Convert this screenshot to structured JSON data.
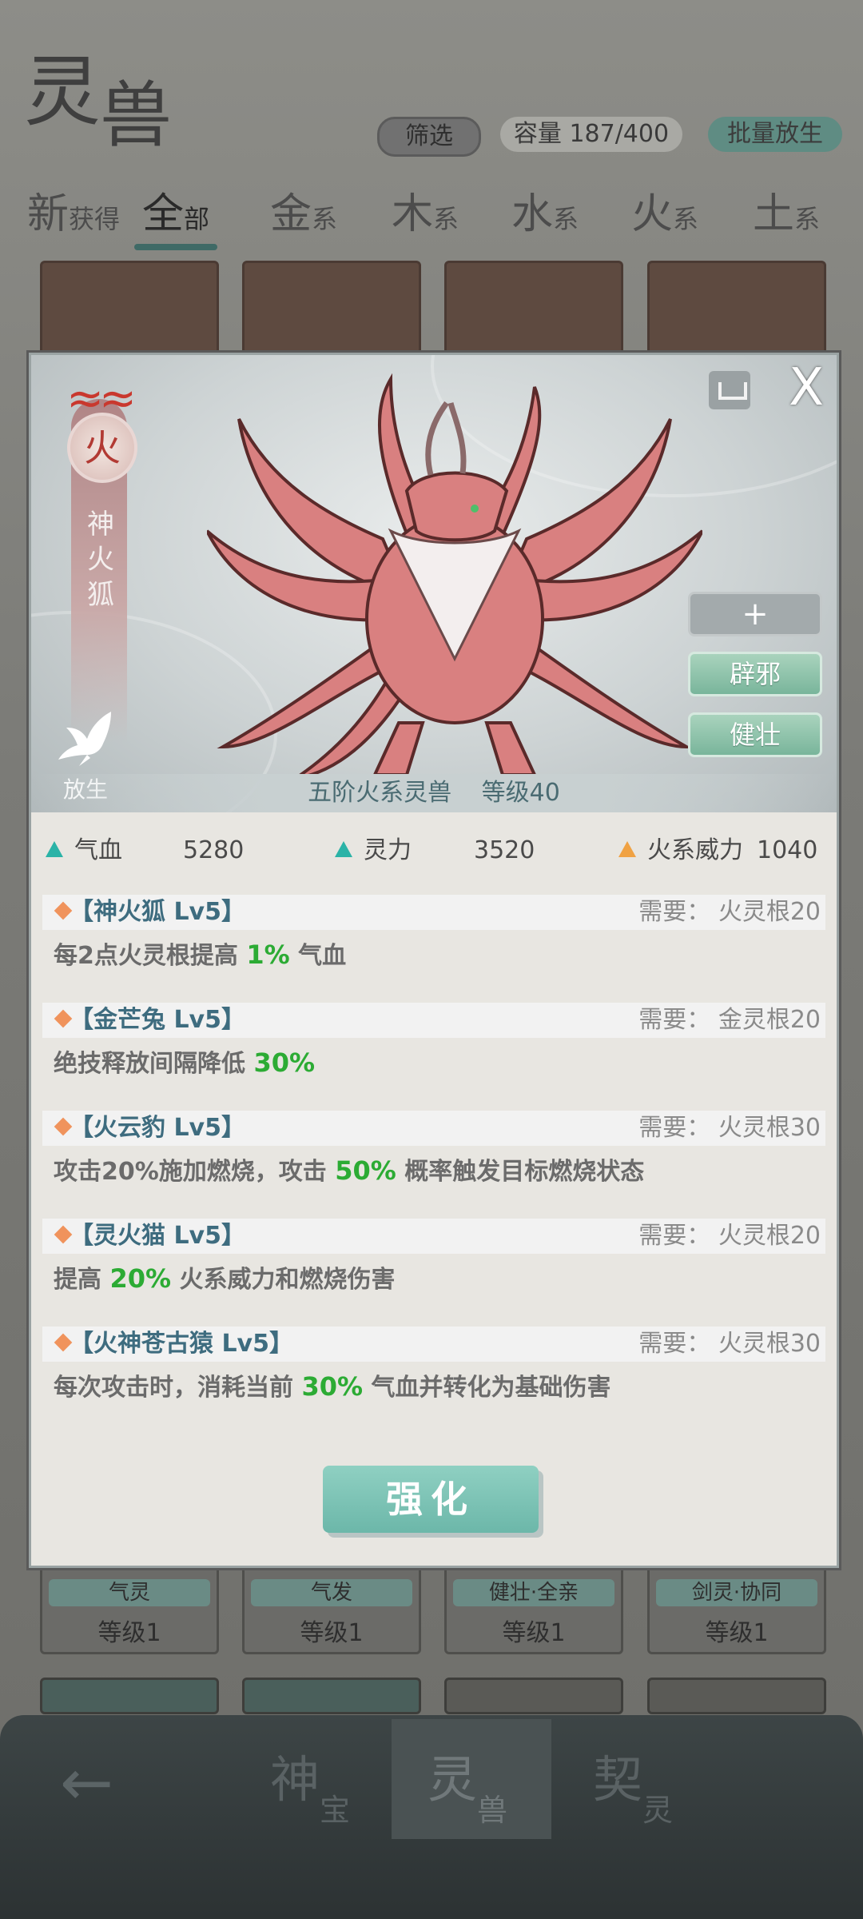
{
  "background": {
    "logo": {
      "char1": "灵",
      "char2": "兽"
    },
    "filter_label": "筛选",
    "capacity_label": "容量 187/400",
    "batch_release_label": "批量放生",
    "tabs": [
      {
        "big": "新",
        "small": "获得"
      },
      {
        "big": "全",
        "small": "部"
      },
      {
        "big": "金",
        "small": "系"
      },
      {
        "big": "木",
        "small": "系"
      },
      {
        "big": "水",
        "small": "系"
      },
      {
        "big": "火",
        "small": "系"
      },
      {
        "big": "土",
        "small": "系"
      }
    ],
    "cards_bottom": [
      {
        "label": "气灵",
        "level": "等级1"
      },
      {
        "label": "气发",
        "level": "等级1"
      },
      {
        "label": "健壮·全亲",
        "level": "等级1"
      },
      {
        "label": "剑灵·协同",
        "level": "等级1"
      }
    ],
    "bottom_nav": [
      {
        "big": "神",
        "small": "宝"
      },
      {
        "big": "灵",
        "small": "兽"
      },
      {
        "big": "契",
        "small": "灵"
      }
    ]
  },
  "modal": {
    "element_char": "火",
    "beast_name": "神火狐",
    "release_label": "放生",
    "close_symbol": "X",
    "plus_symbol": "+",
    "traits": [
      "辟邪",
      "健壮"
    ],
    "rank_text": "五阶火系灵兽",
    "level_text": "等级40",
    "stats": [
      {
        "label": "气血",
        "value": "5280"
      },
      {
        "label": "灵力",
        "value": "3520"
      },
      {
        "label": "火系威力",
        "value": "1040"
      }
    ],
    "skills": [
      {
        "name": "【神火狐 Lv5】",
        "req": "需要：  火灵根20",
        "pre": "每2点火灵根提高 ",
        "hl": "1%",
        "post": " 气血"
      },
      {
        "name": "【金芒兔 Lv5】",
        "req": "需要：  金灵根20",
        "pre": "绝技释放间隔降低 ",
        "hl": "30%",
        "post": ""
      },
      {
        "name": "【火云豹 Lv5】",
        "req": "需要：  火灵根30",
        "pre": "攻击20%施加燃烧，攻击 ",
        "hl": "50%",
        "post": " 概率触发目标燃烧状态"
      },
      {
        "name": "【灵火猫 Lv5】",
        "req": "需要：  火灵根20",
        "pre": "提高 ",
        "hl": "20%",
        "post": " 火系威力和燃烧伤害"
      },
      {
        "name": "【火神苍古猿 Lv5】",
        "req": "需要：  火灵根30",
        "pre": "每次攻击时，消耗当前 ",
        "hl": "30%",
        "post": " 气血并转化为基础伤害"
      }
    ],
    "enhance_label": "强化"
  },
  "colors": {
    "accent_teal": "#6cb7a9",
    "highlight_green": "#2cab34",
    "stat_value_blue": "#3e6c7f",
    "fire_red": "#c9382e"
  },
  "icons": [
    "bookmark-icon",
    "close-icon",
    "dove-icon",
    "fire-element-icon",
    "back-arrow-icon",
    "plus-icon"
  ]
}
